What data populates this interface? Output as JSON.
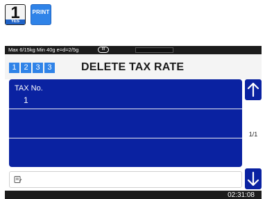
{
  "keys": {
    "number": "1",
    "number_sublabel": "YES",
    "print_label": "PRINT"
  },
  "status_bar": {
    "spec": "Max 6/15kg Min 40g e=d=2/5g",
    "class_badge": "III"
  },
  "header": {
    "steps": [
      "1",
      "2",
      "3",
      "3"
    ],
    "title": "DELETE TAX RATE"
  },
  "list": {
    "rows": [
      {
        "label": "TAX No.",
        "value": "1"
      },
      {
        "label": "",
        "value": ""
      },
      {
        "label": "",
        "value": ""
      }
    ]
  },
  "scroll": {
    "up_icon": "arrow-up-icon",
    "down_icon": "arrow-down-icon",
    "page_indicator": "1/1"
  },
  "input": {
    "icon": "memo-icon",
    "value": ""
  },
  "footer": {
    "clock": "02:31:08"
  },
  "colors": {
    "accent_blue": "#2f83e8",
    "list_navy": "#0a22a1",
    "bar_dark": "#1c1c1c"
  }
}
